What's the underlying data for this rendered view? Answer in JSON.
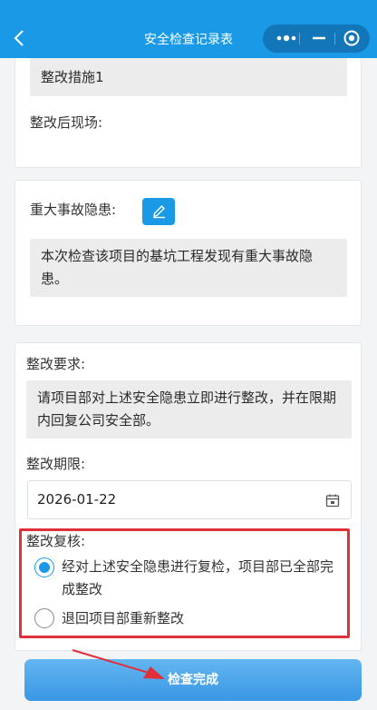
{
  "navbar": {
    "title": "安全检查记录表"
  },
  "section1": {
    "measures_text": "整改措施1",
    "after_site_label": "整改后现场:"
  },
  "section2": {
    "hazard_label": "重大事故隐患:",
    "hazard_text": "本次检查该项目的基坑工程发现有重大事故隐患。"
  },
  "section3": {
    "requirement_label": "整改要求:",
    "requirement_text": "请项目部对上述安全隐患立即进行整改，并在限期内回复公司安全部。",
    "deadline_label": "整改期限:",
    "deadline_value": "2026-01-22",
    "review_label": "整改复核:",
    "options": [
      {
        "label": "经对上述安全隐患进行复检，项目部已全部完成整改",
        "selected": true
      },
      {
        "label": "退回项目部重新整改",
        "selected": false
      }
    ]
  },
  "footer": {
    "done_label": "检查完成"
  },
  "colors": {
    "primary": "#1a9ae6",
    "highlight": "#e0303a"
  }
}
